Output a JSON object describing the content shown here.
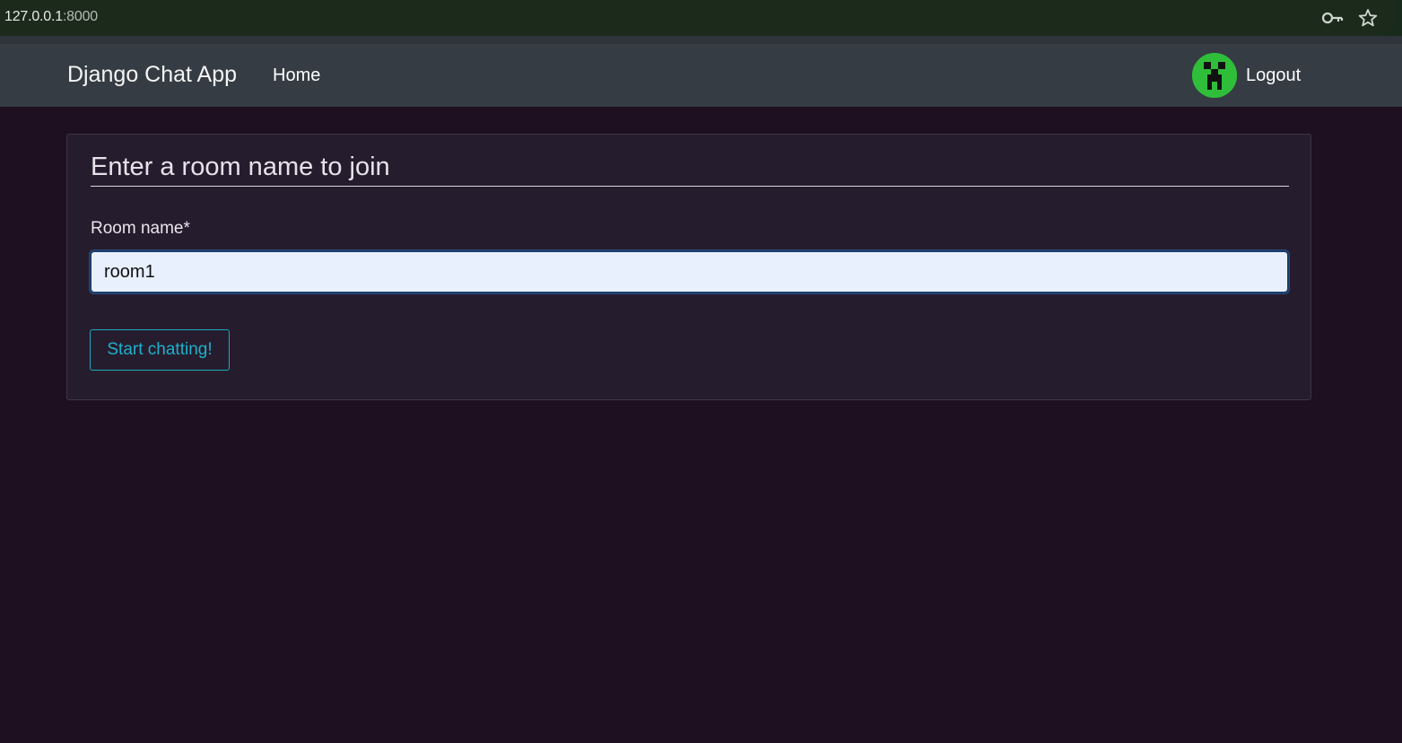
{
  "browser": {
    "url_host": "127.0.0.1",
    "url_port": ":8000",
    "icons": [
      "key-icon",
      "star-icon"
    ]
  },
  "navbar": {
    "brand": "Django Chat App",
    "home_label": "Home",
    "logout_label": "Logout",
    "avatar_icon": "creeper-avatar"
  },
  "form": {
    "title": "Enter a room name to join",
    "room_label": "Room name*",
    "room_value": "room1",
    "submit_label": "Start chatting!"
  },
  "colors": {
    "page_bg": "#1e1020",
    "navbar_bg": "#363c43",
    "card_bg": "#251d2d",
    "accent": "#1eb0cc",
    "avatar_green": "#2fbe3a"
  }
}
